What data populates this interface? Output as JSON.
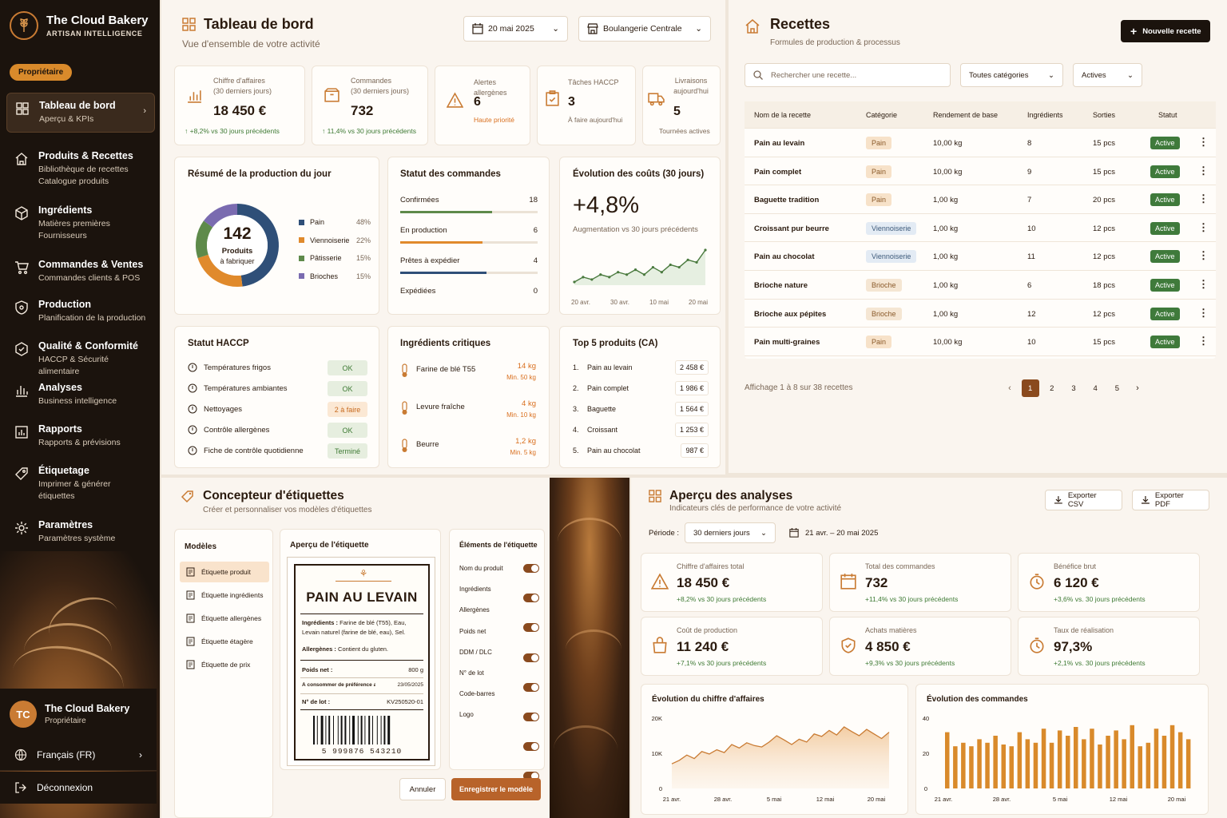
{
  "sidebar": {
    "brand_title": "The Cloud Bakery",
    "brand_sub": "ARTISAN INTELLIGENCE",
    "role_pill": "Propriétaire",
    "items": [
      {
        "title": "Tableau de bord",
        "sub": [
          "Aperçu & KPIs"
        ],
        "icon": "grid-icon"
      },
      {
        "title": "Produits & Recettes",
        "sub": [
          "Bibliothèque de recettes",
          "Catalogue produits"
        ],
        "icon": "house-icon"
      },
      {
        "title": "Ingrédients",
        "sub": [
          "Matières premières",
          "Fournisseurs"
        ],
        "icon": "cube-icon"
      },
      {
        "title": "Commandes & Ventes",
        "sub": [
          "Commandes clients & POS"
        ],
        "icon": "cart-icon"
      },
      {
        "title": "Production",
        "sub": [
          "Planification de la production"
        ],
        "icon": "shield-icon"
      },
      {
        "title": "Qualité & Conformité",
        "sub": [
          "HACCP & Sécurité alimentaire"
        ],
        "icon": "badge-icon"
      },
      {
        "title": "Analyses",
        "sub": [
          "Business intelligence"
        ],
        "icon": "bar-chart-icon"
      },
      {
        "title": "Rapports",
        "sub": [
          "Rapports & prévisions"
        ],
        "icon": "report-icon"
      },
      {
        "title": "Étiquetage",
        "sub": [
          "Imprimer & générer",
          "étiquettes"
        ],
        "icon": "tag-icon"
      },
      {
        "title": "Paramètres",
        "sub": [
          "Paramètres système"
        ],
        "icon": "gear-icon"
      }
    ],
    "user_initials": "TC",
    "user_name": "The Cloud Bakery",
    "user_role": "Propriétaire",
    "language": "Français (FR)",
    "logout": "Déconnexion"
  },
  "dashboard": {
    "title": "Tableau de bord",
    "subtitle": "Vue d'ensemble de votre activité",
    "date": "20 mai 2025",
    "store": "Boulangerie Centrale",
    "kpis": [
      {
        "label1": "Chiffre d'affaires",
        "label2": "(30 derniers jours)",
        "value": "18 450 €",
        "note": "↑ +8,2% vs 30 jours précédents"
      },
      {
        "label1": "Commandes",
        "label2": "(30 derniers jours)",
        "value": "732",
        "note": "↑ 11,4% vs 30 jours précédents"
      },
      {
        "label1": "Alertes allergènes",
        "label2": "",
        "value": "6",
        "note": "Haute priorité"
      },
      {
        "label1": "Tâches HACCP",
        "label2": "",
        "value": "3",
        "note": "À faire aujourd'hui"
      },
      {
        "label1": "Livraisons",
        "label2": "aujourd'hui",
        "value": "5",
        "note": "Tournées actives"
      }
    ],
    "production": {
      "title": "Résumé de la production du jour",
      "total": "142",
      "total_label1": "Produits",
      "total_label2": "à fabriquer",
      "legend": [
        {
          "name": "Pain",
          "pct": "48%",
          "color": "#2f4f78"
        },
        {
          "name": "Viennoiserie",
          "pct": "22%",
          "color": "#e08a2c"
        },
        {
          "name": "Pâtisserie",
          "pct": "15%",
          "color": "#5e8a4a"
        },
        {
          "name": "Brioches",
          "pct": "15%",
          "color": "#7a6bb0"
        }
      ]
    },
    "orders_status": {
      "title": "Statut des commandes",
      "rows": [
        {
          "label": "Confirmées",
          "value": "18",
          "fill": 0.67,
          "color": "#5e8a4a"
        },
        {
          "label": "En production",
          "value": "6",
          "fill": 0.6,
          "color": "#e08a2c"
        },
        {
          "label": "Prêtes à expédier",
          "value": "4",
          "fill": 0.63,
          "color": "#2f4f78"
        },
        {
          "label": "Expédiées",
          "value": "0",
          "fill": 0,
          "color": "#999"
        }
      ]
    },
    "costs": {
      "title": "Évolution des coûts (30 jours)",
      "value": "+4,8%",
      "note": "Augmentation vs 30 jours précédents",
      "xticks": [
        "20 avr.",
        "30 avr.",
        "10 mai",
        "20 mai"
      ]
    },
    "haccp": {
      "title": "Statut HACCP",
      "rows": [
        {
          "label": "Températures frigos",
          "status": "OK",
          "kind": "ok",
          "icon": "thermometer-icon"
        },
        {
          "label": "Températures ambiantes",
          "status": "OK",
          "kind": "ok",
          "icon": "thermometer-icon"
        },
        {
          "label": "Nettoyages",
          "status": "2 à faire",
          "kind": "todo",
          "icon": "broom-icon"
        },
        {
          "label": "Contrôle allergènes",
          "status": "OK",
          "kind": "ok",
          "icon": "warning-icon"
        },
        {
          "label": "Fiche de contrôle quotidienne",
          "status": "Terminé",
          "kind": "done",
          "icon": "checklist-icon"
        }
      ]
    },
    "critical": {
      "title": "Ingrédients critiques",
      "rows": [
        {
          "name": "Farine de blé T55",
          "qty": "14 kg",
          "min": "Min. 50 kg"
        },
        {
          "name": "Levure fraîche",
          "qty": "4 kg",
          "min": "Min. 10 kg"
        },
        {
          "name": "Beurre",
          "qty": "1,2 kg",
          "min": "Min. 5 kg"
        }
      ]
    },
    "top5": {
      "title": "Top 5 produits (CA)",
      "rows": [
        {
          "rank": "1.",
          "name": "Pain au levain",
          "value": "2 458 €"
        },
        {
          "rank": "2.",
          "name": "Pain complet",
          "value": "1 986 €"
        },
        {
          "rank": "3.",
          "name": "Baguette",
          "value": "1 564 €"
        },
        {
          "rank": "4.",
          "name": "Croissant",
          "value": "1 253 €"
        },
        {
          "rank": "5.",
          "name": "Pain au chocolat",
          "value": "987 €"
        }
      ]
    }
  },
  "recipes": {
    "title": "Recettes",
    "subtitle": "Formules de production & processus",
    "new_button": "Nouvelle recette",
    "search_placeholder": "Rechercher une recette...",
    "filter_category": "Toutes catégories",
    "filter_status": "Actives",
    "headers": [
      "Nom de la recette",
      "Catégorie",
      "Rendement de base",
      "Ingrédients",
      "Sorties",
      "Statut"
    ],
    "rows": [
      {
        "name": "Pain au levain",
        "cat": "Pain",
        "kind": "pain",
        "yield": "10,00 kg",
        "ing": "8",
        "out": "15 pcs",
        "status": "Active"
      },
      {
        "name": "Pain complet",
        "cat": "Pain",
        "kind": "pain",
        "yield": "10,00 kg",
        "ing": "9",
        "out": "15 pcs",
        "status": "Active"
      },
      {
        "name": "Baguette tradition",
        "cat": "Pain",
        "kind": "pain",
        "yield": "1,00 kg",
        "ing": "7",
        "out": "20 pcs",
        "status": "Active"
      },
      {
        "name": "Croissant pur beurre",
        "cat": "Viennoiserie",
        "kind": "vien",
        "yield": "1,00 kg",
        "ing": "10",
        "out": "12 pcs",
        "status": "Active"
      },
      {
        "name": "Pain au chocolat",
        "cat": "Viennoiserie",
        "kind": "vien",
        "yield": "1,00 kg",
        "ing": "11",
        "out": "12 pcs",
        "status": "Active"
      },
      {
        "name": "Brioche nature",
        "cat": "Brioche",
        "kind": "brio",
        "yield": "1,00 kg",
        "ing": "6",
        "out": "18 pcs",
        "status": "Active"
      },
      {
        "name": "Brioche aux pépites",
        "cat": "Brioche",
        "kind": "brio",
        "yield": "1,00 kg",
        "ing": "12",
        "out": "12 pcs",
        "status": "Active"
      },
      {
        "name": "Pain multi-graines",
        "cat": "Pain",
        "kind": "pain",
        "yield": "10,00 kg",
        "ing": "10",
        "out": "15 pcs",
        "status": "Active"
      }
    ],
    "footer": "Affichage 1 à 8 sur 38 recettes",
    "pages": [
      "1",
      "2",
      "3",
      "4",
      "5"
    ]
  },
  "labels": {
    "title": "Concepteur d'étiquettes",
    "subtitle": "Créer et personnaliser vos modèles d'étiquettes",
    "models_title": "Modèles",
    "models": [
      "Étiquette produit",
      "Étiquette ingrédients",
      "Étiquette allergènes",
      "Étiquette étagère",
      "Étiquette de prix"
    ],
    "preview_title": "Aperçu de l'étiquette",
    "preview": {
      "product": "PAIN AU LEVAIN",
      "ingredients_label": "Ingrédients :",
      "ingredients_text": "Farine de blé (T55), Eau, Levain naturel (farine de blé, eau), Sel.",
      "allergens_label": "Allergènes :",
      "allergens_text": "Contient du gluten.",
      "weight_label": "Poids net :",
      "weight": "800 g",
      "best_label": "À consommer de préférence avant le :",
      "best": "23/05/2025",
      "lot_label": "N° de lot :",
      "lot": "KV250520-01",
      "barcode": "5  999876  543210"
    },
    "elements_title": "Éléments de l'étiquette",
    "elements": [
      "Nom du produit",
      "Ingrédients",
      "Allergènes",
      "Poids net",
      "DDM / DLC",
      "N° de lot",
      "Code-barres",
      "Logo"
    ],
    "cancel": "Annuler",
    "save": "Enregistrer le modèle"
  },
  "analytics": {
    "title": "Aperçu des analyses",
    "subtitle": "Indicateurs clés de performance de votre activité",
    "export_csv": "Exporter CSV",
    "export_pdf": "Exporter PDF",
    "period_label": "Période :",
    "period": "30 derniers jours",
    "range": "21 avr. – 20 mai 2025",
    "kpis": [
      {
        "label": "Chiffre d'affaires total",
        "value": "18 450 €",
        "note": "+8,2% vs 30 jours précédents",
        "icon": "warning-icon"
      },
      {
        "label": "Total des commandes",
        "value": "732",
        "note": "+11,4% vs 30 jours précédents",
        "icon": "calendar-icon"
      },
      {
        "label": "Bénéfice brut",
        "value": "6 120 €",
        "note": "+3,6% vs. 30 jours précédents",
        "icon": "timer-icon"
      },
      {
        "label": "Coût de production",
        "value": "11 240 €",
        "note": "+7,1% vs 30 jours précédents",
        "icon": "bag-icon"
      },
      {
        "label": "Achats matières",
        "value": "4 850 €",
        "note": "+9,3% vs 30 jours précédents",
        "icon": "shield-icon"
      },
      {
        "label": "Taux de réalisation",
        "value": "97,3%",
        "note": "+2,1% vs. 30 jours précédents",
        "icon": "timer-icon"
      }
    ],
    "revenue_chart_title": "Évolution du chiffre d'affaires",
    "orders_chart_title": "Évolution des commandes",
    "xticks": [
      "21 avr.",
      "28 avr.",
      "5 mai",
      "12 mai",
      "20 mai"
    ]
  },
  "chart_data": [
    {
      "type": "pie",
      "title": "Résumé de la production du jour",
      "categories": [
        "Pain",
        "Viennoiserie",
        "Pâtisserie",
        "Brioches"
      ],
      "values": [
        48,
        22,
        15,
        15
      ]
    },
    {
      "type": "line",
      "title": "Évolution des coûts (30 jours)",
      "x": [
        "20 avr.",
        "",
        "",
        "",
        "",
        "30 avr.",
        "",
        "",
        "",
        "",
        "10 mai",
        "",
        "",
        "",
        "",
        "20 mai"
      ],
      "values": [
        3,
        5,
        4,
        6,
        5,
        7,
        6,
        8,
        6,
        9,
        7,
        10,
        9,
        12,
        11,
        16
      ]
    },
    {
      "type": "area",
      "title": "Évolution du chiffre d'affaires",
      "xticks": [
        "21 avr.",
        "28 avr.",
        "5 mai",
        "12 mai",
        "20 mai"
      ],
      "ylim": [
        0,
        20000
      ],
      "yticks": [
        "0",
        "10K",
        "20K"
      ],
      "values": [
        7000,
        8000,
        9500,
        8500,
        10500,
        9800,
        11000,
        10200,
        12500,
        11500,
        13000,
        12200,
        11800,
        13200,
        15000,
        13800,
        12500,
        14000,
        13200,
        15500,
        14800,
        16500,
        15200,
        17500,
        16200,
        15000,
        16800,
        15500,
        14200,
        16000
      ]
    },
    {
      "type": "bar",
      "title": "Évolution des commandes",
      "xticks": [
        "21 avr.",
        "28 avr.",
        "5 mai",
        "12 mai",
        "20 mai"
      ],
      "ylim": [
        0,
        40
      ],
      "yticks": [
        "0",
        "20",
        "40"
      ],
      "values": [
        32,
        24,
        26,
        24,
        28,
        26,
        30,
        25,
        24,
        32,
        28,
        26,
        34,
        26,
        33,
        30,
        35,
        28,
        34,
        25,
        30,
        33,
        28,
        36,
        24,
        26,
        34,
        30,
        36,
        32,
        28
      ]
    }
  ]
}
